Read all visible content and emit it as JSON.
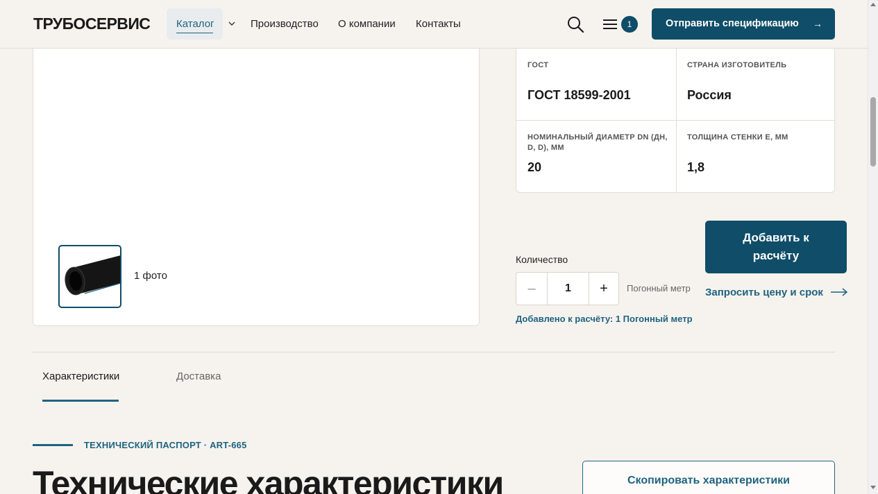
{
  "header": {
    "logo": "ТРУБОСЕРВИС",
    "nav": {
      "catalog": "Каталог",
      "production": "Производство",
      "about": "О компании",
      "contacts": "Контакты"
    },
    "menu_badge": "1",
    "spec_button": "Отправить спецификацию",
    "spec_arrow": "→"
  },
  "gallery": {
    "photo_count": "1 фото"
  },
  "specs": {
    "items": [
      {
        "label": "ГОСТ",
        "value": "ГОСТ 18599-2001"
      },
      {
        "label": "СТРАНА ИЗГОТОВИТЕЛЬ",
        "value": "Россия"
      },
      {
        "label": "НОМИНАЛЬНЫЙ ДИАМЕТР DN (ДН, D, D), ММ",
        "value": "20"
      },
      {
        "label": "ТОЛЩИНА СТЕНКИ E, ММ",
        "value": "1,8"
      }
    ]
  },
  "order": {
    "quantity_label": "Количество",
    "minus": "–",
    "quantity_value": "1",
    "plus": "+",
    "unit": "Погонный метр",
    "added_text": "Добавлено к расчёту: 1 Погонный метр",
    "add_button": "Добавить к расчёту",
    "price_link": "Запросить цену и срок"
  },
  "tabs": [
    {
      "label": "Характеристики",
      "active": true
    },
    {
      "label": "Доставка",
      "active": false
    }
  ],
  "section": {
    "kicker": "ТЕХНИЧЕСКИЙ ПАСПОРТ · ART-665",
    "title": "Технические характеристики",
    "copy_button": "Скопировать характеристики"
  },
  "colors": {
    "accent": "#0f4d68",
    "link": "#1f6380",
    "background": "#f6f3ee"
  }
}
